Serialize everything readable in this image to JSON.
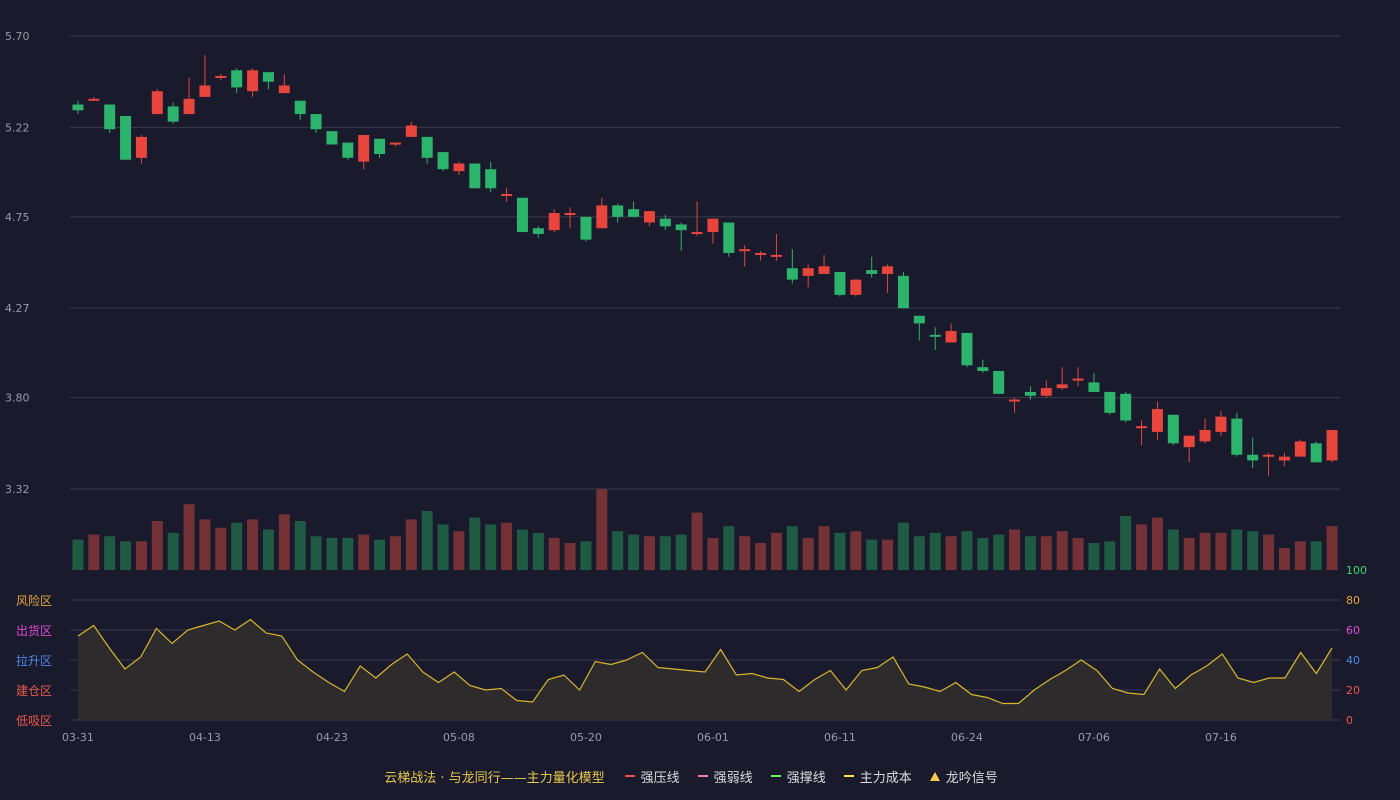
{
  "colors": {
    "background": "#1a1a2d",
    "up": "#e8453c",
    "down": "#2cb46c",
    "up_volume": "#743236",
    "down_volume": "#1f5a43",
    "grid": "#3a3a4e",
    "axis_text": "#9a9aa8",
    "osc_line": "#d9b52a",
    "osc_fill": "#2e2b2c"
  },
  "chart_data": [
    {
      "type": "candlestick",
      "title": "",
      "y_ticks": [
        "5.70",
        "5.22",
        "4.75",
        "4.27",
        "3.80",
        "3.32"
      ],
      "ylim": [
        3.32,
        5.7
      ],
      "x_ticks": [
        {
          "index": 0,
          "label": "03-31"
        },
        {
          "index": 8,
          "label": "04-13"
        },
        {
          "index": 16,
          "label": "04-23"
        },
        {
          "index": 24,
          "label": "05-08"
        },
        {
          "index": 32,
          "label": "05-20"
        },
        {
          "index": 40,
          "label": "06-01"
        },
        {
          "index": 48,
          "label": "06-11"
        },
        {
          "index": 56,
          "label": "06-24"
        },
        {
          "index": 64,
          "label": "07-06"
        },
        {
          "index": 72,
          "label": "07-16"
        }
      ],
      "candles": [
        [
          5.34,
          5.31,
          5.36,
          5.29
        ],
        [
          5.37,
          5.37,
          5.38,
          5.36
        ],
        [
          5.34,
          5.21,
          5.34,
          5.19
        ],
        [
          5.28,
          5.05,
          5.28,
          5.05
        ],
        [
          5.06,
          5.17,
          5.18,
          5.03
        ],
        [
          5.29,
          5.41,
          5.42,
          5.29
        ],
        [
          5.33,
          5.25,
          5.35,
          5.24
        ],
        [
          5.29,
          5.37,
          5.48,
          5.29
        ],
        [
          5.38,
          5.44,
          5.6,
          5.38
        ],
        [
          5.48,
          5.49,
          5.5,
          5.47
        ],
        [
          5.52,
          5.43,
          5.53,
          5.4
        ],
        [
          5.41,
          5.52,
          5.53,
          5.38
        ],
        [
          5.51,
          5.46,
          5.51,
          5.42
        ],
        [
          5.4,
          5.44,
          5.5,
          5.4
        ],
        [
          5.36,
          5.29,
          5.36,
          5.26
        ],
        [
          5.29,
          5.21,
          5.29,
          5.19
        ],
        [
          5.2,
          5.13,
          5.2,
          5.13
        ],
        [
          5.14,
          5.06,
          5.14,
          5.05
        ],
        [
          5.04,
          5.18,
          5.18,
          5.0
        ],
        [
          5.16,
          5.08,
          5.16,
          5.06
        ],
        [
          5.13,
          5.14,
          5.14,
          5.12
        ],
        [
          5.17,
          5.23,
          5.25,
          5.17
        ],
        [
          5.17,
          5.06,
          5.17,
          5.03
        ],
        [
          5.09,
          5.0,
          5.09,
          4.99
        ],
        [
          4.99,
          5.03,
          5.04,
          4.97
        ],
        [
          5.03,
          4.9,
          5.03,
          4.9
        ],
        [
          5.0,
          4.9,
          5.04,
          4.88
        ],
        [
          4.87,
          4.87,
          4.9,
          4.83
        ],
        [
          4.85,
          4.67,
          4.85,
          4.67
        ],
        [
          4.69,
          4.66,
          4.7,
          4.64
        ],
        [
          4.68,
          4.77,
          4.79,
          4.67
        ],
        [
          4.77,
          4.77,
          4.8,
          4.69
        ],
        [
          4.75,
          4.63,
          4.75,
          4.62
        ],
        [
          4.69,
          4.81,
          4.85,
          4.69
        ],
        [
          4.81,
          4.75,
          4.82,
          4.72
        ],
        [
          4.79,
          4.75,
          4.83,
          4.75
        ],
        [
          4.72,
          4.78,
          4.78,
          4.7
        ],
        [
          4.74,
          4.7,
          4.76,
          4.68
        ],
        [
          4.71,
          4.68,
          4.72,
          4.57
        ],
        [
          4.66,
          4.67,
          4.83,
          4.65
        ],
        [
          4.67,
          4.74,
          4.74,
          4.61
        ],
        [
          4.72,
          4.56,
          4.72,
          4.54
        ],
        [
          4.57,
          4.58,
          4.6,
          4.49
        ],
        [
          4.55,
          4.56,
          4.57,
          4.52
        ],
        [
          4.54,
          4.55,
          4.66,
          4.52
        ],
        [
          4.48,
          4.42,
          4.58,
          4.4
        ],
        [
          4.44,
          4.48,
          4.5,
          4.38
        ],
        [
          4.45,
          4.49,
          4.55,
          4.45
        ],
        [
          4.46,
          4.34,
          4.46,
          4.33
        ],
        [
          4.34,
          4.42,
          4.42,
          4.33
        ],
        [
          4.47,
          4.45,
          4.54,
          4.43
        ],
        [
          4.45,
          4.49,
          4.5,
          4.35
        ],
        [
          4.44,
          4.27,
          4.46,
          4.27
        ],
        [
          4.23,
          4.19,
          4.23,
          4.1
        ],
        [
          4.13,
          4.12,
          4.17,
          4.05
        ],
        [
          4.09,
          4.15,
          4.19,
          4.09
        ],
        [
          4.14,
          3.97,
          4.14,
          3.96
        ],
        [
          3.96,
          3.94,
          4.0,
          3.93
        ],
        [
          3.94,
          3.82,
          3.94,
          3.82
        ],
        [
          3.78,
          3.79,
          3.8,
          3.72
        ],
        [
          3.83,
          3.81,
          3.86,
          3.79
        ],
        [
          3.81,
          3.85,
          3.89,
          3.8
        ],
        [
          3.85,
          3.87,
          3.96,
          3.84
        ],
        [
          3.9,
          3.9,
          3.96,
          3.86
        ],
        [
          3.88,
          3.83,
          3.93,
          3.83
        ],
        [
          3.83,
          3.72,
          3.83,
          3.71
        ],
        [
          3.82,
          3.68,
          3.83,
          3.67
        ],
        [
          3.64,
          3.65,
          3.68,
          3.55
        ],
        [
          3.62,
          3.74,
          3.78,
          3.58
        ],
        [
          3.71,
          3.56,
          3.71,
          3.55
        ],
        [
          3.54,
          3.6,
          3.6,
          3.46
        ],
        [
          3.57,
          3.63,
          3.69,
          3.56
        ],
        [
          3.62,
          3.7,
          3.73,
          3.6
        ],
        [
          3.69,
          3.5,
          3.72,
          3.49
        ],
        [
          3.5,
          3.47,
          3.59,
          3.43
        ],
        [
          3.49,
          3.5,
          3.51,
          3.39
        ],
        [
          3.47,
          3.49,
          3.51,
          3.44
        ],
        [
          3.49,
          3.57,
          3.58,
          3.49
        ],
        [
          3.56,
          3.46,
          3.57,
          3.46
        ],
        [
          3.47,
          3.63,
          3.63,
          3.46
        ]
      ],
      "candle_fields": [
        "open",
        "close",
        "high",
        "low"
      ]
    },
    {
      "type": "bar",
      "series_name": "volume",
      "values": [
        1.8,
        2.1,
        2.0,
        1.7,
        1.7,
        2.9,
        2.2,
        3.9,
        3.0,
        2.5,
        2.8,
        3.0,
        2.4,
        3.3,
        2.9,
        2.0,
        1.9,
        1.9,
        2.1,
        1.8,
        2.0,
        3.0,
        3.5,
        2.7,
        2.3,
        3.1,
        2.7,
        2.8,
        2.4,
        2.2,
        1.9,
        1.6,
        1.7,
        4.8,
        2.3,
        2.1,
        2.0,
        2.0,
        2.1,
        3.4,
        1.9,
        2.6,
        2.0,
        1.6,
        2.2,
        2.6,
        1.9,
        2.6,
        2.2,
        2.3,
        1.8,
        1.8,
        2.8,
        2.0,
        2.2,
        2.0,
        2.3,
        1.9,
        2.1,
        2.4,
        2.0,
        2.0,
        2.3,
        1.9,
        1.6,
        1.7,
        3.2,
        2.7,
        3.1,
        2.4,
        1.9,
        2.2,
        2.2,
        2.4,
        2.3,
        2.1,
        1.3,
        1.7,
        1.7,
        2.6
      ],
      "volume_max": 4.8
    },
    {
      "type": "line",
      "series_name": "",
      "ylim": [
        0,
        100
      ],
      "right_ticks": [
        {
          "value": 100,
          "label": "100",
          "color": "#3cd66a"
        },
        {
          "value": 80,
          "label": "80",
          "color": "#e8a33a"
        },
        {
          "value": 60,
          "label": "60",
          "color": "#e04ad6"
        },
        {
          "value": 40,
          "label": "40",
          "color": "#4a8ae8"
        },
        {
          "value": 20,
          "label": "20",
          "color": "#e85a4a"
        },
        {
          "value": 0,
          "label": "0",
          "color": "#e85a4a"
        }
      ],
      "zones": [
        {
          "value": 80,
          "label": "风险区",
          "color": "#e8a33a"
        },
        {
          "value": 60,
          "label": "出货区",
          "color": "#e04ad6"
        },
        {
          "value": 40,
          "label": "拉升区",
          "color": "#4a8ae8"
        },
        {
          "value": 20,
          "label": "建仓区",
          "color": "#e85a4a"
        },
        {
          "value": 0,
          "label": "低吸区",
          "color": "#e85a4a"
        }
      ],
      "values": [
        56,
        63,
        48,
        34,
        42,
        61,
        51,
        60,
        63,
        66,
        60,
        67,
        58,
        56,
        40,
        32,
        25,
        19,
        36,
        28,
        37,
        44,
        32,
        25,
        32,
        23,
        20,
        21,
        13,
        12,
        27,
        30,
        20,
        39,
        37,
        40,
        45,
        35,
        34,
        33,
        32,
        47,
        30,
        31,
        28,
        27,
        19,
        27,
        33,
        20,
        33,
        35,
        42,
        24,
        22,
        19,
        25,
        17,
        15,
        11,
        11,
        20,
        27,
        33,
        40,
        33,
        21,
        18,
        17,
        34,
        21,
        30,
        36,
        44,
        28,
        25,
        28,
        28,
        45,
        31,
        48
      ]
    }
  ],
  "legend": {
    "title": "云梯战法 · 与龙同行——主力量化模型",
    "items": [
      {
        "label": "强压线",
        "color": "#ff4a4a",
        "style": "solid"
      },
      {
        "label": "强弱线",
        "color": "#ff7b9c",
        "style": "dashed"
      },
      {
        "label": "强撑线",
        "color": "#55ff55",
        "style": "solid"
      },
      {
        "label": "主力成本",
        "color": "#ffe04a",
        "style": "dashed"
      },
      {
        "label": "龙吟信号",
        "color": "#ffc94a",
        "style": "triangle"
      }
    ]
  }
}
